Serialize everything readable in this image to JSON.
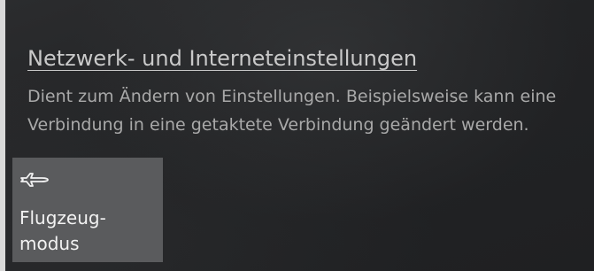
{
  "network_settings": {
    "link_label": "Netzwerk- und Interneteinstellungen",
    "description_line1": "Dient zum Ändern von Einstellungen. Beispielsweise kann eine",
    "description_line2": "Verbindung in eine getaktete Verbindung geändert werden."
  },
  "quick_actions": [
    {
      "label_line1": "Flugzeug-",
      "label_line2": "modus",
      "icon": "airplane-icon"
    }
  ],
  "colors": {
    "background": "#232425",
    "tile": "#5a5b5d",
    "link_text": "#c9c9c9",
    "description_text": "#a9a9a9",
    "tile_text": "#f2f2f2"
  }
}
